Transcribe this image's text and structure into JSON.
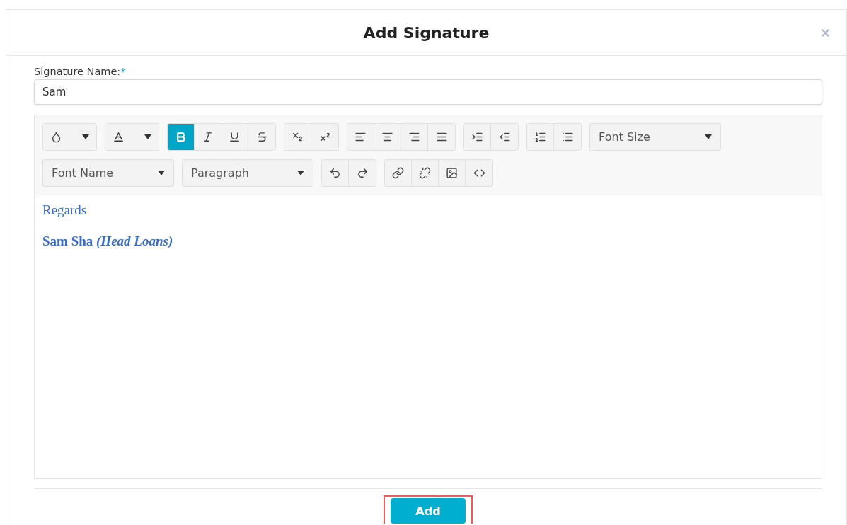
{
  "dialog": {
    "title": "Add Signature"
  },
  "field": {
    "label": "Signature Name:",
    "required_mark": "*",
    "value": "Sam"
  },
  "toolbar": {
    "format_buttons": [
      {
        "active": true
      },
      {
        "active": false
      },
      {
        "active": false
      },
      {
        "active": false
      }
    ],
    "font_size": "Font Size",
    "font_name": "Font Name",
    "block_format": "Paragraph"
  },
  "content": [
    {
      "text": "Regards",
      "bold": false
    },
    {
      "text": "Sam Sha *(Head Loans)*",
      "bold": true
    }
  ],
  "footer": {
    "button": "Add",
    "highlighted": true
  }
}
